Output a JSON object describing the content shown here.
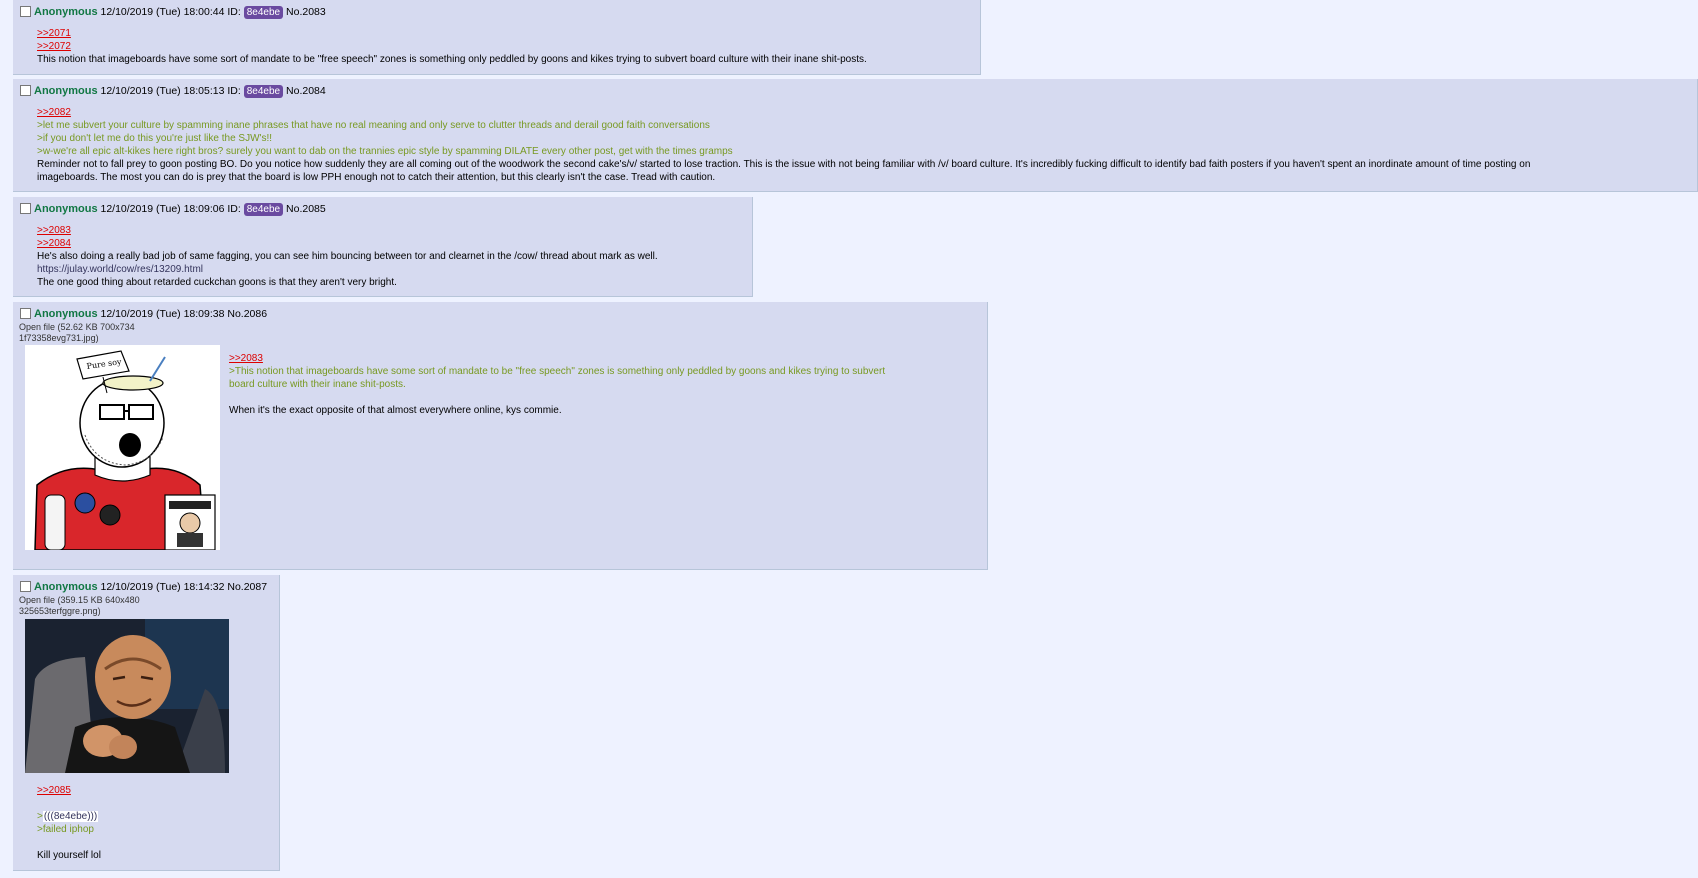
{
  "posts": [
    {
      "no": "No.2083",
      "name": "Anonymous",
      "date": "12/10/2019 (Tue) 18:00:44",
      "id_label": "ID:",
      "id": "8e4ebe",
      "lines": [
        ">>2071",
        ">>2072",
        "This notion that imageboards have some sort of mandate to be \"free speech\" zones is something only peddled by goons and kikes trying to subvert board culture with their inane shit-posts."
      ]
    },
    {
      "no": "No.2084",
      "name": "Anonymous",
      "date": "12/10/2019 (Tue) 18:05:13",
      "id_label": "ID:",
      "id": "8e4ebe",
      "lines": [
        ">>2082",
        ">let me subvert your culture by spamming inane phrases that have no real meaning and only serve to clutter threads and derail good faith conversations",
        ">if you don't let me do this you're just like the SJW's!!",
        ">w-we're all epic alt-kikes here right bros? surely you want to dab on the trannies epic style by spamming DILATE every other post, get with the times gramps",
        "Reminder not to fall prey to goon posting BO. Do you notice how suddenly they are all coming out of the woodwork the second cake's/v/ started to lose traction. This is the issue with not being familiar with /v/ board culture. It's incredibly fucking difficult to identify bad faith posters if you haven't spent an inordinate amount of time posting on",
        "imageboards. The most you can do is prey that the board is low PPH enough not to catch their attention, but this clearly isn't the case. Tread with caution."
      ]
    },
    {
      "no": "No.2085",
      "name": "Anonymous",
      "date": "12/10/2019 (Tue) 18:09:06",
      "id_label": "ID:",
      "id": "8e4ebe",
      "lines": [
        ">>2083",
        ">>2084",
        "He's also doing a really bad job of same fagging, you can see him bouncing between tor and clearnet in the /cow/ thread about mark as well.",
        "https://julay.world/cow/res/13209.html",
        "The one good thing about retarded cuckchan goons is that they aren't very bright."
      ]
    },
    {
      "no": "No.2086",
      "name": "Anonymous",
      "date": "12/10/2019 (Tue) 18:09:38",
      "file_link": "Open file",
      "file_meta": "(52.62 KB 700x734",
      "file_name": "1f73358evg731.jpg)",
      "sign_text": "Pure soy",
      "lines": [
        ">>2083",
        ">This notion that imageboards have some sort of mandate to be \"free speech\" zones is something only peddled by goons and kikes trying to subvert",
        "board culture with their inane shit-posts.",
        "",
        "When it's the exact opposite of that almost everywhere online, kys commie."
      ]
    },
    {
      "no": "No.2087",
      "name": "Anonymous",
      "date": "12/10/2019 (Tue) 18:14:32",
      "file_link": "Open file",
      "file_meta": "(359.15 KB 640x480",
      "file_name": "325653terfggre.png)",
      "lines": [
        ">>2085",
        "",
        "(((8e4ebe)))",
        ">failed iphop",
        "",
        "Kill yourself lol"
      ]
    }
  ],
  "colors": {
    "background": "#eef2ff",
    "post": "#d6daf0",
    "name": "#117743",
    "quotelink": "#dd0000",
    "greentext": "#789922",
    "id_badge": "#6a4aa0"
  }
}
